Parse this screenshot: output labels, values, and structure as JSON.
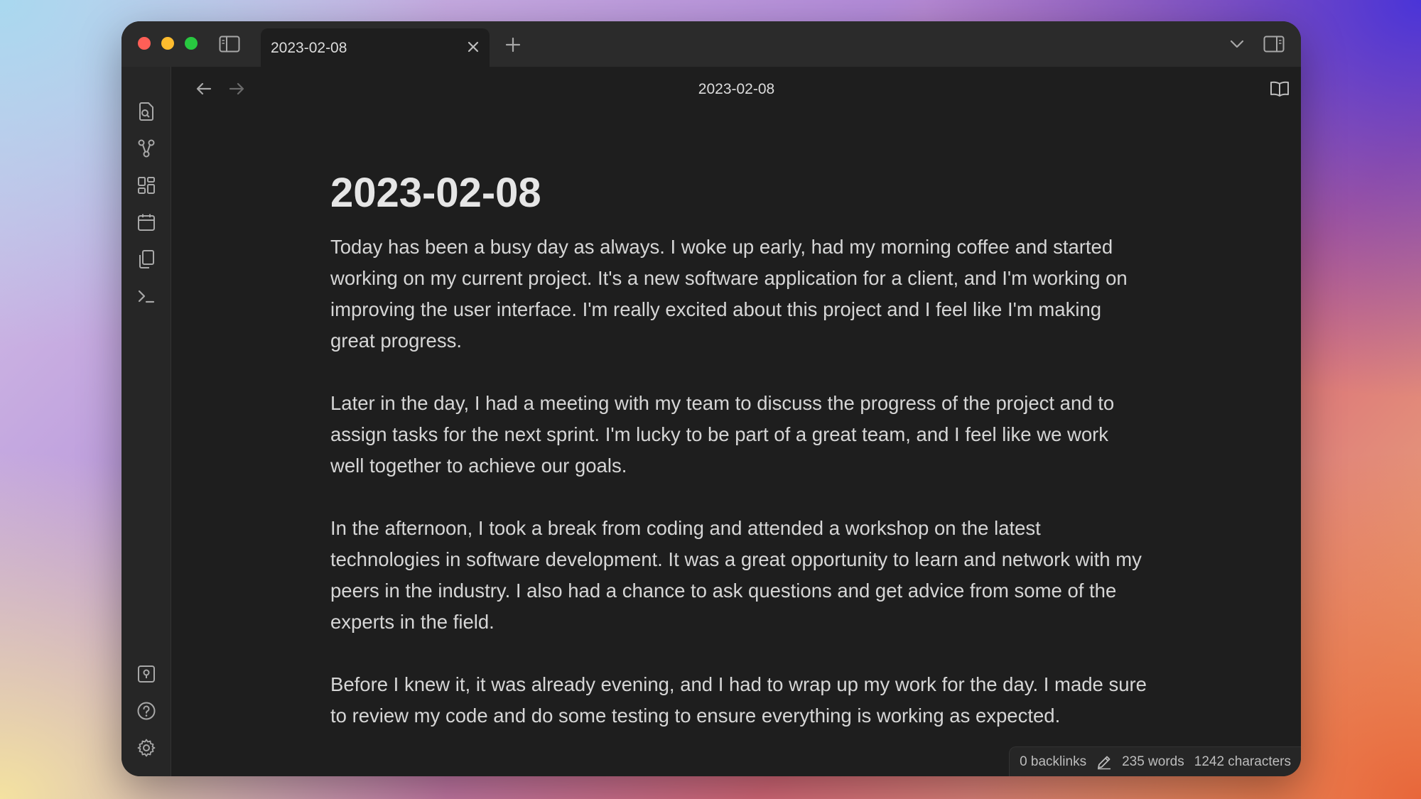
{
  "tab": {
    "title": "2023-02-08"
  },
  "header": {
    "title": "2023-02-08"
  },
  "document": {
    "title": "2023-02-08",
    "paragraphs": [
      "Today has been a busy day as always. I woke up early, had my morning coffee and started working on my current project. It's a new software application for a client, and I'm working on improving the user interface. I'm really excited about this project and I feel like I'm making great progress.",
      "Later in the day, I had a meeting with my team to discuss the progress of the project and to assign tasks for the next sprint. I'm lucky to be part of a great team, and I feel like we work well together to achieve our goals.",
      "In the afternoon, I took a break from coding and attended a workshop on the latest technologies in software development. It was a great opportunity to learn and network with my peers in the industry. I also had a chance to ask questions and get advice from some of the experts in the field.",
      "Before I knew it, it was already evening, and I had to wrap up my work for the day. I made sure to review my code and do some testing to ensure everything is working as expected."
    ]
  },
  "status": {
    "backlinks": "0 backlinks",
    "words": "235 words",
    "characters": "1242 characters"
  },
  "icons": {
    "sidebar_toggle": "sidebar-toggle-icon",
    "close": "close-icon",
    "new_tab": "plus-icon",
    "tab_list": "chevron-down-icon",
    "right_sidebar": "right-sidebar-icon",
    "back": "arrow-left-icon",
    "forward": "arrow-right-icon",
    "reading_view": "book-open-icon",
    "more": "more-vertical-icon",
    "ribbon": [
      "quick-switcher-icon",
      "graph-view-icon",
      "canvas-icon",
      "daily-note-icon",
      "templates-icon",
      "command-palette-icon",
      "vault-icon",
      "help-icon",
      "settings-icon"
    ]
  },
  "colors": {
    "window_bg": "#1e1e1e",
    "titlebar_bg": "#2b2b2b",
    "text": "#dadada"
  }
}
